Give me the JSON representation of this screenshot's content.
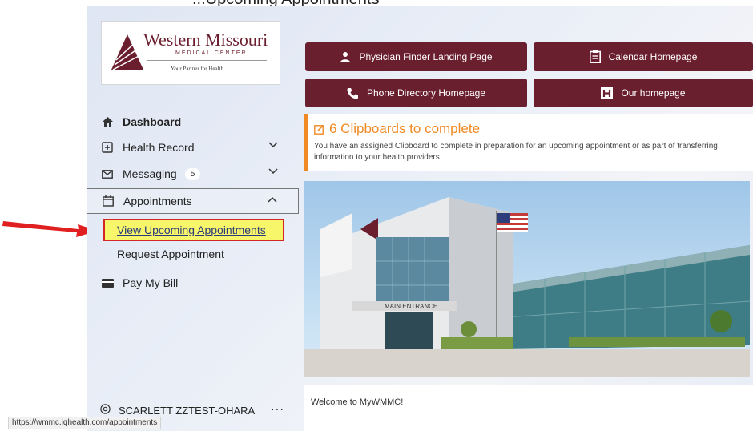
{
  "page_caption": "...Upcoming Appointments",
  "logo": {
    "name": "Western Missouri",
    "subname": "MEDICAL CENTER",
    "tagline": "Your Partner for Health."
  },
  "sidebar": {
    "items": [
      {
        "label": "Dashboard",
        "icon": "home-icon"
      },
      {
        "label": "Health Record",
        "icon": "medical-record-icon"
      },
      {
        "label": "Messaging",
        "icon": "envelope-icon",
        "badge": "5"
      },
      {
        "label": "Appointments",
        "icon": "calendar-icon"
      },
      {
        "label": "Pay My Bill",
        "icon": "credit-card-icon"
      }
    ],
    "appointments_sub": {
      "view_upcoming": "View Upcoming Appointments",
      "request": "Request Appointment"
    },
    "user_name": "SCARLETT ZZTEST-OHARA",
    "more_label": "···"
  },
  "status_url": "https://wmmc.iqhealth.com/appointments",
  "quick_links": [
    {
      "label": "Physician Finder Landing Page",
      "icon": "doctor-icon"
    },
    {
      "label": "Calendar Homepage",
      "icon": "clipboard-list-icon"
    },
    {
      "label": "Phone Directory Homepage",
      "icon": "phone-icon"
    },
    {
      "label": "Our homepage",
      "icon": "hospital-h-icon"
    }
  ],
  "notice": {
    "title": "6 Clipboards to complete",
    "text": "You have an assigned Clipboard to complete in preparation for an upcoming appointment or as part of transferring information to your health providers."
  },
  "hero_sign": "MAIN ENTRANCE",
  "welcome_text": "Welcome to MyWMMC!",
  "colors": {
    "brand": "#6a1f2e",
    "accent_orange": "#f08a24",
    "highlight_yellow": "#f7f56a",
    "annotation_red": "#d32626"
  }
}
